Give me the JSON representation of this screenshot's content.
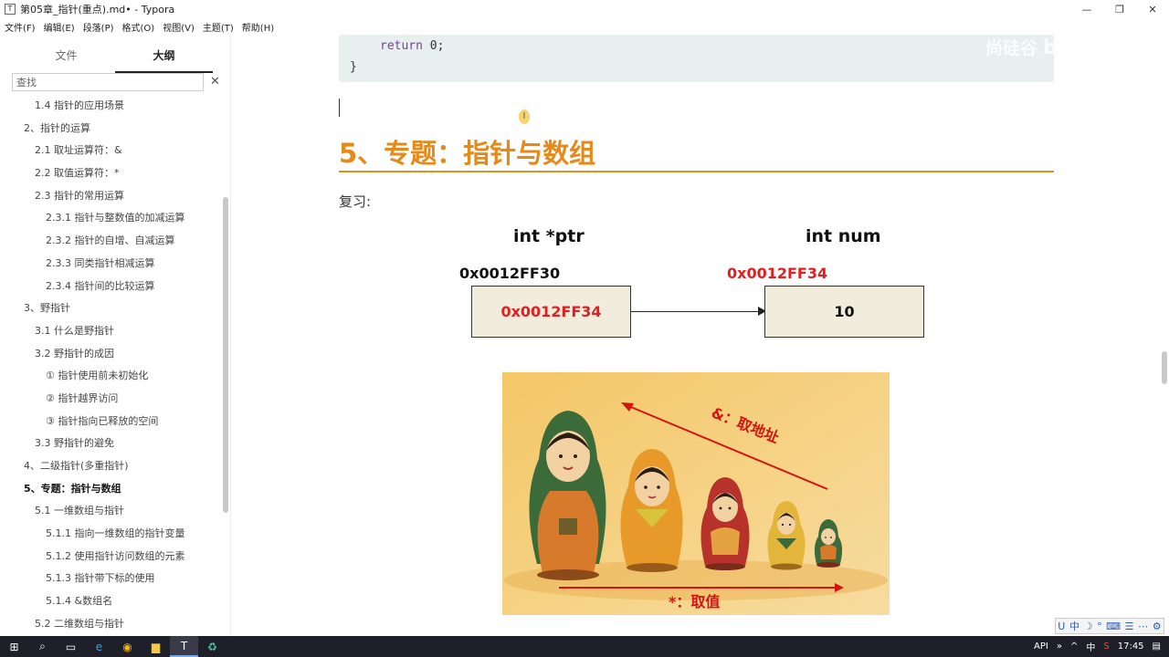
{
  "window": {
    "title": "第05章_指针(重点).md• - Typora",
    "app_icon": "T",
    "minimize_glyph": "—",
    "maximize_glyph": "❐",
    "close_glyph": "✕"
  },
  "menu": [
    "文件(F)",
    "编辑(E)",
    "段落(P)",
    "格式(O)",
    "视图(V)",
    "主题(T)",
    "帮助(H)"
  ],
  "sidebar": {
    "tabs": [
      "文件",
      "大纲"
    ],
    "search_placeholder": "查找",
    "clear_glyph": "✕",
    "outline": [
      {
        "text": "1.4 指针的应用场景",
        "level": "l2"
      },
      {
        "text": "2、指针的运算",
        "level": "l1"
      },
      {
        "text": "2.1 取址运算符：&",
        "level": "l2"
      },
      {
        "text": "2.2 取值运算符：*",
        "level": "l2"
      },
      {
        "text": "2.3 指针的常用运算",
        "level": "l2"
      },
      {
        "text": "2.3.1 指针与整数值的加减运算",
        "level": "l3"
      },
      {
        "text": "2.3.2 指针的自增、自减运算",
        "level": "l3"
      },
      {
        "text": "2.3.3 同类指针相减运算",
        "level": "l3"
      },
      {
        "text": "2.3.4 指针间的比较运算",
        "level": "l3"
      },
      {
        "text": "3、野指针",
        "level": "l1"
      },
      {
        "text": "3.1 什么是野指针",
        "level": "l2"
      },
      {
        "text": "3.2 野指针的成因",
        "level": "l2"
      },
      {
        "text": "① 指针使用前未初始化",
        "level": "l3"
      },
      {
        "text": "② 指针越界访问",
        "level": "l3"
      },
      {
        "text": "③ 指针指向已释放的空间",
        "level": "l3"
      },
      {
        "text": "3.3 野指针的避免",
        "level": "l2"
      },
      {
        "text": "4、二级指针(多重指针)",
        "level": "l1"
      },
      {
        "text": "5、专题：指针与数组",
        "level": "l1",
        "active": true
      },
      {
        "text": "5.1 一维数组与指针",
        "level": "l2"
      },
      {
        "text": "5.1.1 指向一维数组的指针变量",
        "level": "l3"
      },
      {
        "text": "5.1.2 使用指针访问数组的元素",
        "level": "l3"
      },
      {
        "text": "5.1.3 指针带下标的使用",
        "level": "l3"
      },
      {
        "text": "5.1.4 &数组名",
        "level": "l3"
      },
      {
        "text": "5.2 二维数组与指针",
        "level": "l2"
      }
    ],
    "footer_prev": "‹",
    "footer_source": "</>"
  },
  "editor": {
    "code_return": "return",
    "code_zero": "0",
    "code_semicolon": ";",
    "code_brace": "}",
    "watermark": "尚硅谷",
    "watermark_brand": "bilibili",
    "cursor_glyph": "I",
    "heading": "5、专题：指针与数组",
    "review_label": "复习:"
  },
  "diagram": {
    "ptr_label": "int *ptr",
    "num_label": "int num",
    "ptr_address": "0x0012FF30",
    "num_address": "0x0012FF34",
    "ptr_value": "0x0012FF34",
    "num_value": "10",
    "addr_color": "#e02020"
  },
  "dolls_image": {
    "address_label": "&：取地址",
    "value_label": "*：取值",
    "annotation_color": "#d41414"
  },
  "ime": {
    "items": [
      "U",
      "中",
      "☽",
      "°",
      "⌨",
      "☰",
      "⋯",
      "⚙"
    ]
  },
  "taskbar": {
    "icons": [
      "windows-logo",
      "search",
      "task-view",
      "edge",
      "chrome",
      "file-explorer",
      "typora",
      "app"
    ],
    "icon_glyphs": [
      "⊞",
      "⌕",
      "▭",
      "e",
      "◉",
      "▆",
      "T",
      "♻"
    ],
    "tray_api": "API",
    "tray_expand": "»",
    "tray_up": "^",
    "tray_lang": "中",
    "tray_s": "S",
    "clock": "17:45",
    "notify_glyph": "▤"
  }
}
